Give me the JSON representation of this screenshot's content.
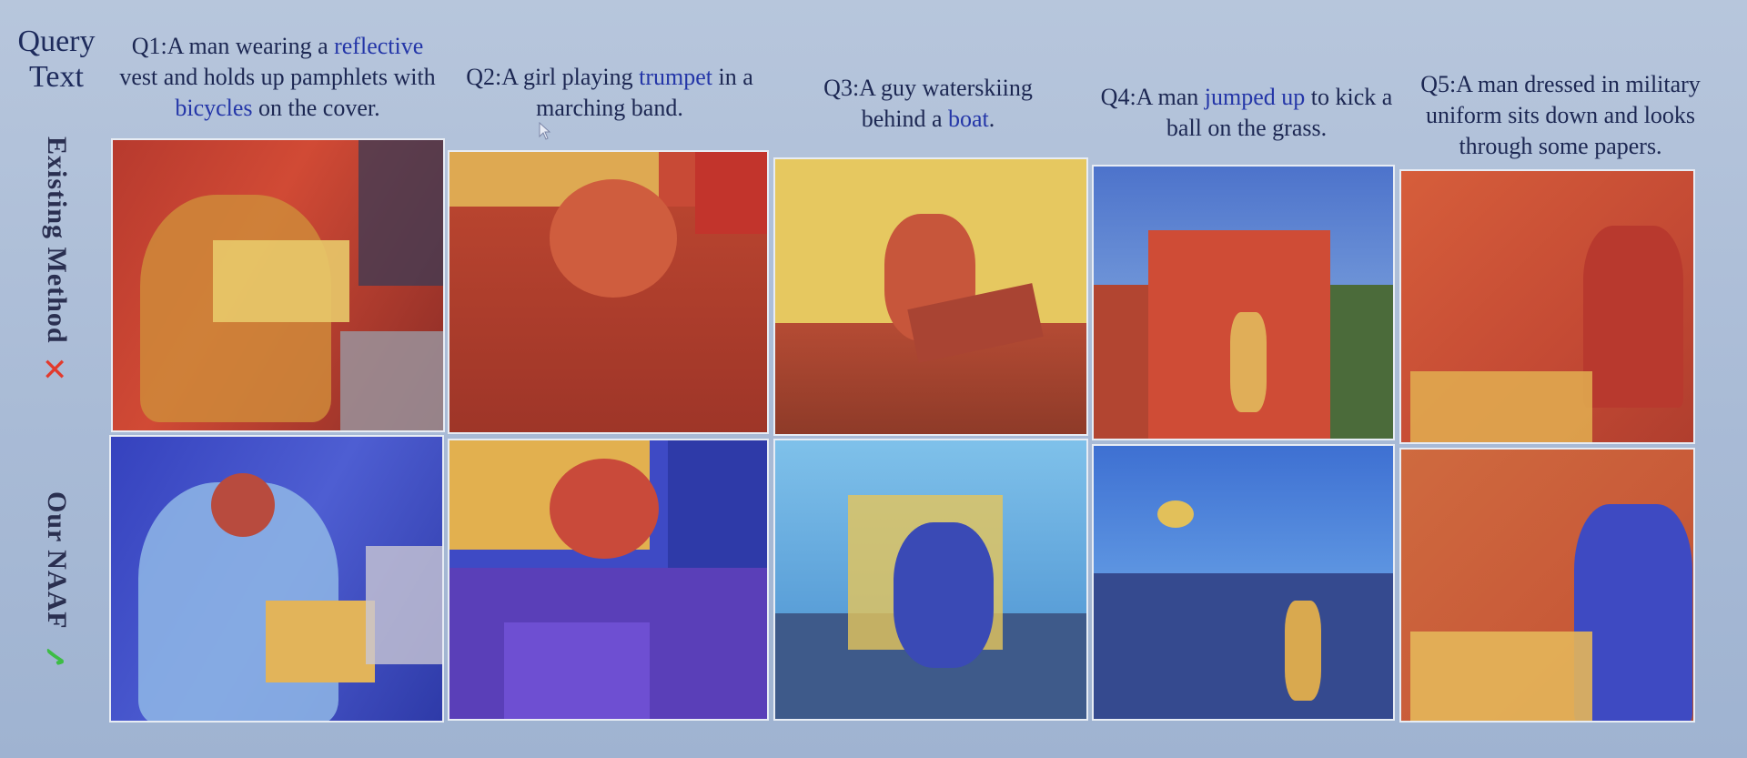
{
  "header": {
    "label": "Query Text"
  },
  "queries": [
    {
      "id": "Q1",
      "parts": [
        "Q1:A man wearing a ",
        "reflective",
        " vest and holds up pamphlets with ",
        "bicycles",
        " on the cover."
      ]
    },
    {
      "id": "Q2",
      "parts": [
        "Q2:A girl playing ",
        "trumpet",
        " in a marching band."
      ]
    },
    {
      "id": "Q3",
      "parts": [
        "Q3:A guy waterskiing behind a ",
        "boat",
        "."
      ]
    },
    {
      "id": "Q4",
      "parts": [
        "Q4:A man ",
        "jumped up",
        " to kick a ball on the grass."
      ]
    },
    {
      "id": "Q5",
      "parts": [
        "Q5:A man dressed in military uniform sits down and looks through some papers."
      ]
    }
  ],
  "rows": [
    {
      "label": "Existing Method",
      "mark": "✕",
      "mark_color": "#e23a2d"
    },
    {
      "label": "Our NAAF",
      "mark": "✓",
      "mark_color": "#3dbd45"
    }
  ],
  "colors": {
    "existing_hot": "#d8462e",
    "existing_warm": "#e6c65a",
    "ours_cool": "#3b48c8",
    "ours_light": "#7fb3e6"
  }
}
